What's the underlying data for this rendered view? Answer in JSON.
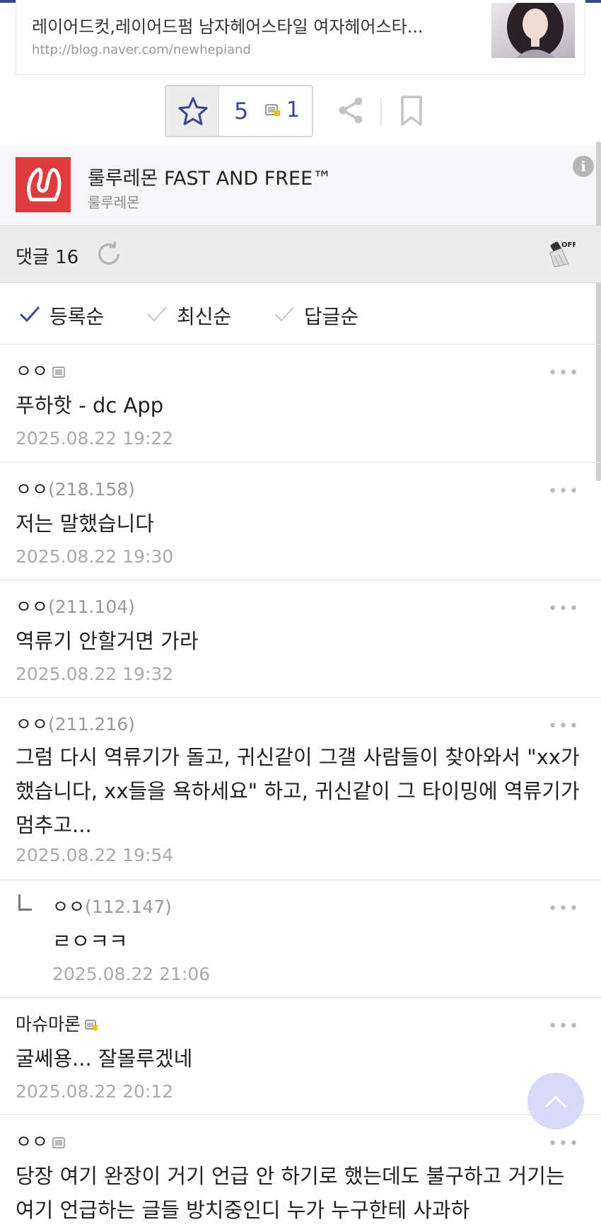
{
  "link_card": {
    "title": "레이어드컷,레이어드펌 남자헤어스타일 여자헤어스타...",
    "url": "http://blog.naver.com/newhepiand"
  },
  "votes": {
    "recommend_count": "5",
    "fixed_recommend_count": "1"
  },
  "ad": {
    "title": "룰루레몬 FAST AND FREE™",
    "brand": "룰루레몬",
    "info": "i"
  },
  "comments_header": {
    "label": "댓글 16"
  },
  "sort": {
    "options": [
      {
        "label": "등록순",
        "selected": true
      },
      {
        "label": "최신순",
        "selected": false
      },
      {
        "label": "답글순",
        "selected": false
      }
    ]
  },
  "comments": [
    {
      "name": "ㅇㅇ",
      "ip": "",
      "body": "푸하핫 - dc App",
      "date": "2025.08.22 19:22"
    },
    {
      "name": "ㅇㅇ",
      "ip": "(218.158)",
      "body": "저는 말했습니다",
      "date": "2025.08.22 19:30"
    },
    {
      "name": "ㅇㅇ",
      "ip": "(211.104)",
      "body": "역류기 안할거면 가라",
      "date": "2025.08.22 19:32"
    },
    {
      "name": "ㅇㅇ",
      "ip": "(211.216)",
      "body": "그럼 다시 역류기가 돌고, 귀신같이 그갤 사람들이 찾아와서 \"xx가 했습니다, xx들을 욕하세요\" 하고, 귀신같이 그 타이밍에 역류기가 멈추고...",
      "date": "2025.08.22 19:54"
    },
    {
      "name": "ㅇㅇ",
      "ip": "(112.147)",
      "body": "ㄹㅇㅋㅋ",
      "date": "2025.08.22 21:06",
      "reply": true
    },
    {
      "name": "마슈마론",
      "ip": "",
      "body": "굴쎄용... 잘몰루겠네",
      "date": "2025.08.22 20:12"
    },
    {
      "name": "ㅇㅇ",
      "ip": "",
      "body": "당장 여기 완장이 거기 언급 안 하기로 했는데도 불구하고 거기는 여기 언급하는 글들 방치중인디 누가 누구한테 사과하",
      "date": ""
    }
  ],
  "more_label": "•••"
}
